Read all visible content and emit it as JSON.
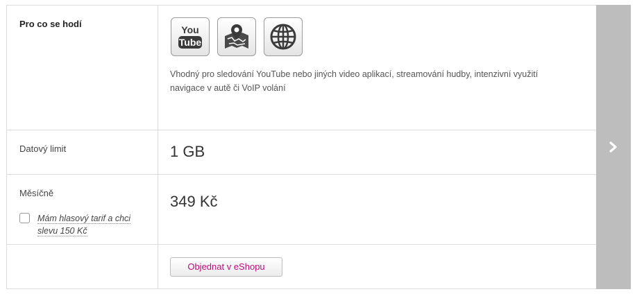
{
  "rows": {
    "usage": {
      "label": "Pro co se hodí",
      "icons": [
        "youtube-icon",
        "map-navigation-icon",
        "globe-icon"
      ],
      "youtube_text_top": "You",
      "youtube_text_bottom": "Tube",
      "description": "Vhodný pro sledování YouTube nebo jiných video aplikací, streamování hudby, intenzivní využití navigace v autě či VoIP volání"
    },
    "data_limit": {
      "label": "Datový limit",
      "value": "1 GB"
    },
    "monthly": {
      "label": "Měsíčně",
      "value": "349 Kč",
      "discount_checkbox_label": "Mám hlasový tarif a chci slevu 150 Kč",
      "discount_checked": false
    },
    "order": {
      "button_label": "Objednat v eShopu"
    }
  },
  "navigation": {
    "next_icon": "chevron-right-icon"
  },
  "colors": {
    "accent": "#c00a7c",
    "panel": "#bdbdbd",
    "border": "#dcdcdc"
  }
}
